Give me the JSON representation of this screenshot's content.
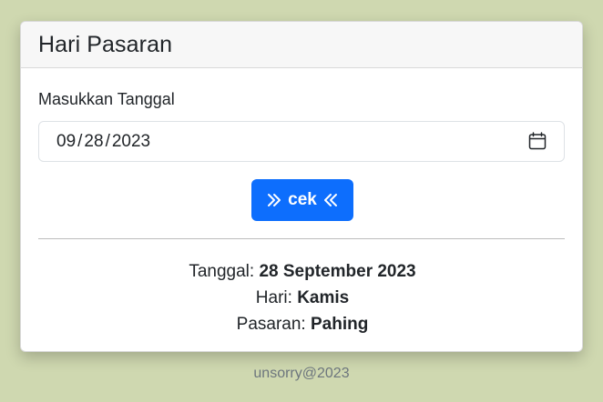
{
  "card": {
    "title": "Hari Pasaran"
  },
  "form": {
    "label": "Masukkan Tanggal",
    "date": {
      "month": "09",
      "day": "28",
      "year": "2023"
    },
    "calendar_icon": "calendar-icon",
    "button": {
      "label": "cek",
      "left_icon": "chevrons-right-icon",
      "right_icon": "chevrons-left-icon"
    }
  },
  "result": {
    "tanggal_label": "Tanggal:",
    "tanggal_value": "28 September 2023",
    "hari_label": "Hari:",
    "hari_value": "Kamis",
    "pasaran_label": "Pasaran:",
    "pasaran_value": "Pahing"
  },
  "footer": {
    "text": "unsorry@2023"
  },
  "colors": {
    "background": "#cfd8b0",
    "button": "#0d6efd",
    "header_bg": "#f7f7f7"
  }
}
